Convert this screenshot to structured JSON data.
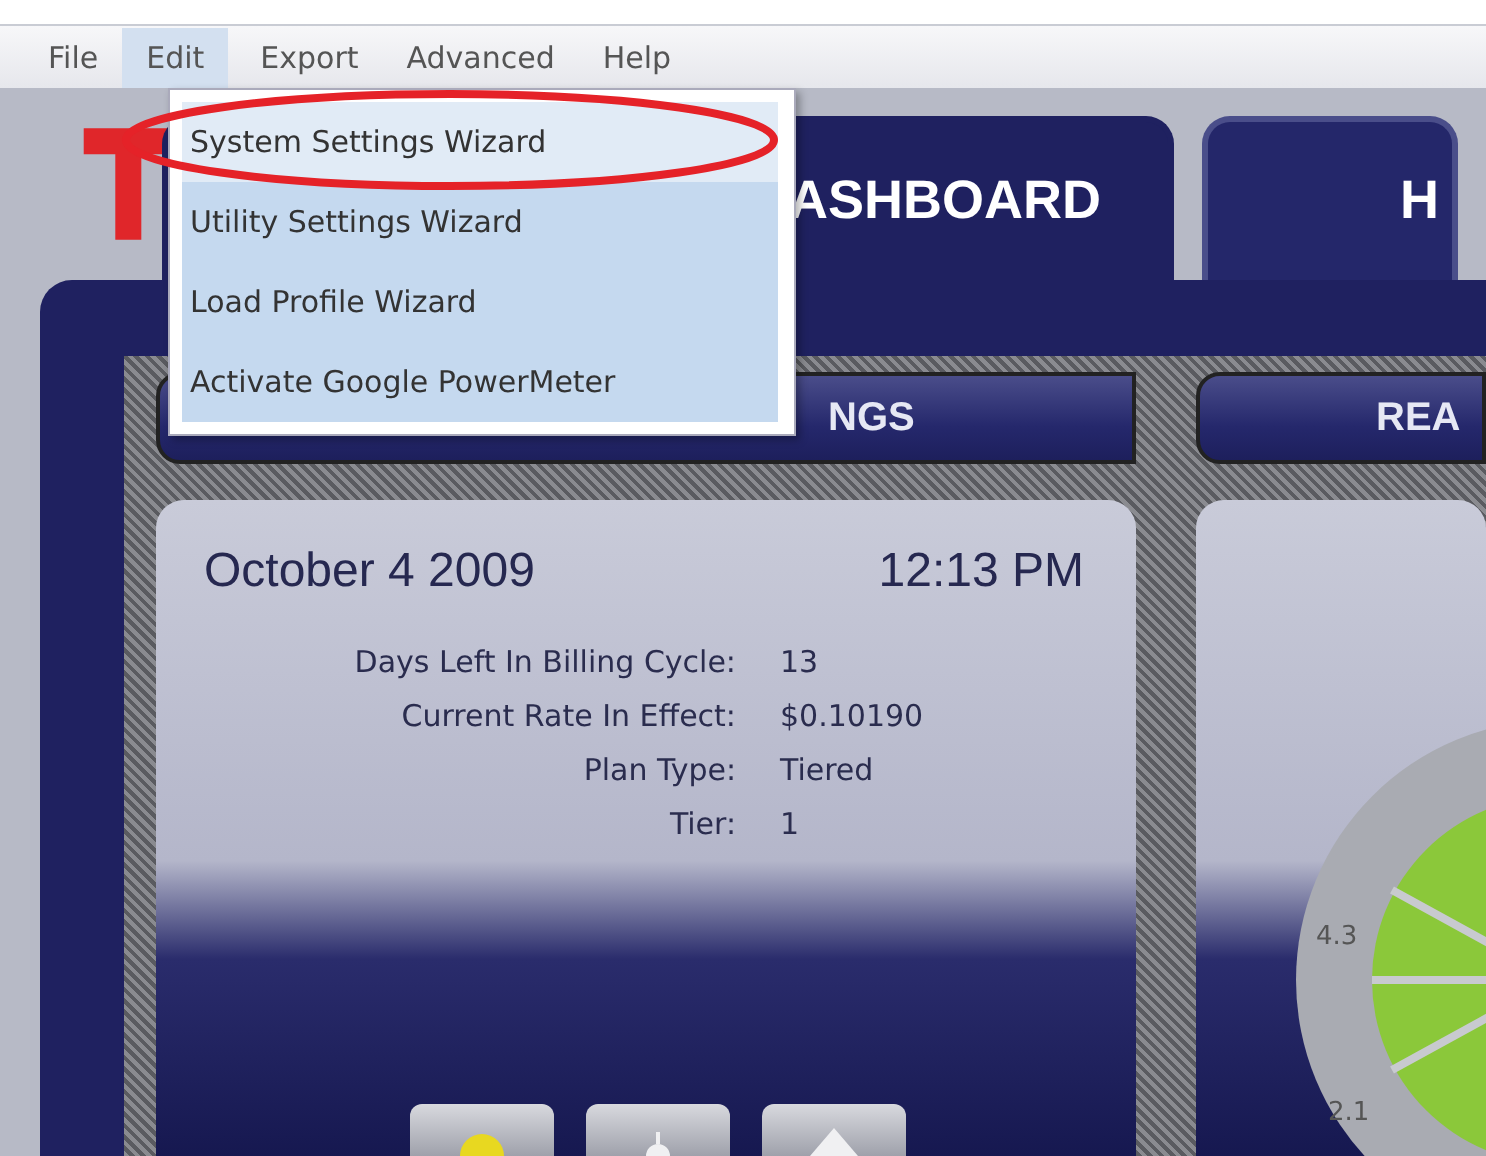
{
  "menu_bar": [
    {
      "label": "File",
      "selected": false
    },
    {
      "label": "Edit",
      "selected": true
    },
    {
      "label": "Export",
      "selected": false
    },
    {
      "label": "Advanced",
      "selected": false
    },
    {
      "label": "Help",
      "selected": false
    }
  ],
  "edit_menu": [
    {
      "label": "System Settings Wizard",
      "selected": true
    },
    {
      "label": "Utility Settings Wizard",
      "selected": false
    },
    {
      "label": "Load Profile Wizard",
      "selected": false
    },
    {
      "label": "Activate Google PowerMeter",
      "selected": false
    }
  ],
  "tabs": [
    {
      "label": "ASHBOARD",
      "selected": true
    },
    {
      "label": "H",
      "selected": false
    }
  ],
  "section_headers": [
    "NGS",
    "REA"
  ],
  "readings": {
    "date": "October 4 2009",
    "time": "12:13 PM",
    "fields": [
      {
        "label": "Days Left In Billing Cycle:",
        "value": "13"
      },
      {
        "label": "Current Rate In Effect:",
        "value": "$0.10190"
      },
      {
        "label": "Plan Type:",
        "value": "Tiered"
      },
      {
        "label": "Tier:",
        "value": "1"
      }
    ]
  },
  "gauge": {
    "labels": [
      "4.3",
      "2.1"
    ]
  }
}
